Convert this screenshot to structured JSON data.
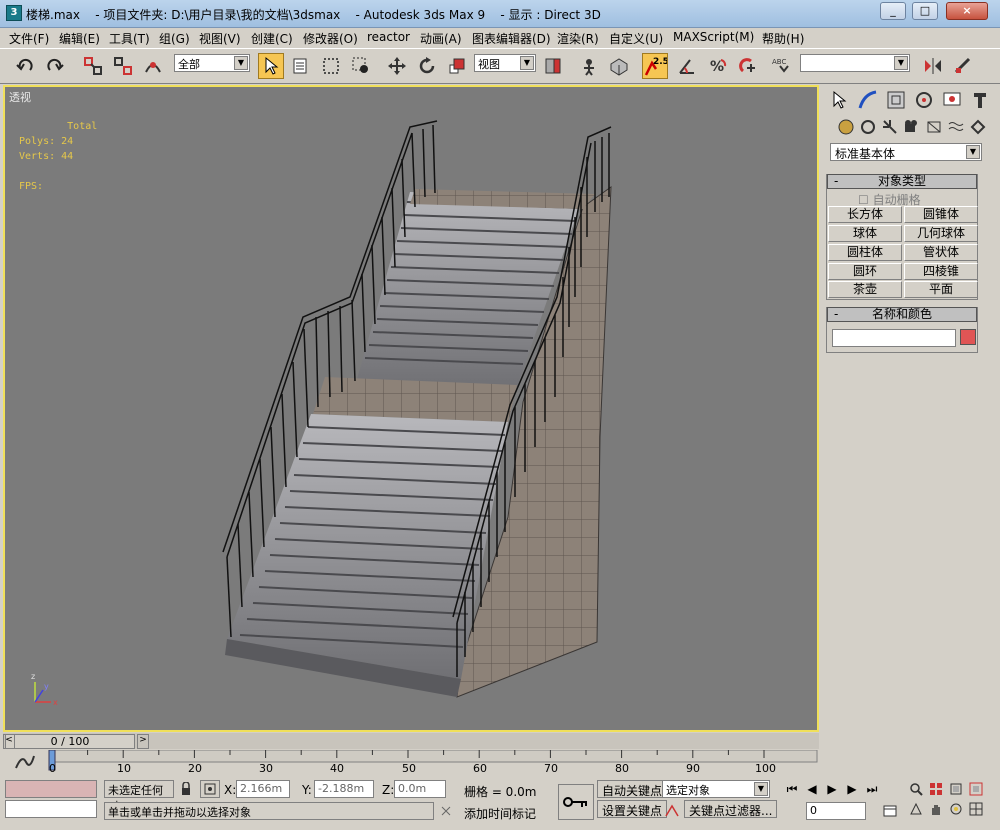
{
  "window": {
    "title": "楼梯.max    - 项目文件夹: D:\\用户目录\\我的文档\\3dsmax    - Autodesk 3ds Max 9    - 显示 : Direct 3D",
    "minimize": "_",
    "maximize": "□",
    "close": "×"
  },
  "menu": [
    "文件(F)",
    "编辑(E)",
    "工具(T)",
    "组(G)",
    "视图(V)",
    "创建(C)",
    "修改器(O)",
    "reactor",
    "动画(A)",
    "图表编辑器(D)",
    "渲染(R)",
    "自定义(U)",
    "MAXScript(M)",
    "帮助(H)"
  ],
  "toolbar": {
    "selection_filter": "全部",
    "coord_system": "视图",
    "snap_value": "2.5",
    "named_selection": ""
  },
  "viewport": {
    "label": "透视",
    "stats": "        Total\nPolys: 24\nVerts: 44\n\nFPS:"
  },
  "command_panel": {
    "category": "标准基本体",
    "object_type_header": "对象类型",
    "autogrid": "自动栅格",
    "objects": [
      "长方体",
      "圆锥体",
      "球体",
      "几何球体",
      "圆柱体",
      "管状体",
      "圆环",
      "四棱锥",
      "茶壶",
      "平面"
    ],
    "name_color_header": "名称和颜色",
    "object_color": "#e05555"
  },
  "timeline": {
    "slider": "0 / 100",
    "ticks": [
      "0",
      "10",
      "20",
      "30",
      "40",
      "50",
      "60",
      "70",
      "80",
      "90",
      "100"
    ]
  },
  "status": {
    "selection": "未选定任何对",
    "x_label": "X:",
    "x_value": "2.166m",
    "y_label": "Y:",
    "y_value": "-2.188m",
    "z_label": "Z:",
    "z_value": "0.0m",
    "grid": "栅格 = 0.0m",
    "prompt": "单击或单击并拖动以选择对象",
    "add_time_tag": "添加时间标记",
    "auto_key": "自动关键点",
    "set_key": "设置关键点",
    "selected_object": "选定对象",
    "key_filters": "关键点过滤器...",
    "frame": "0"
  },
  "colors": {
    "accent": "#f6c653",
    "viewport_border": "#f0e05a",
    "stats_text": "#e6c84a"
  }
}
